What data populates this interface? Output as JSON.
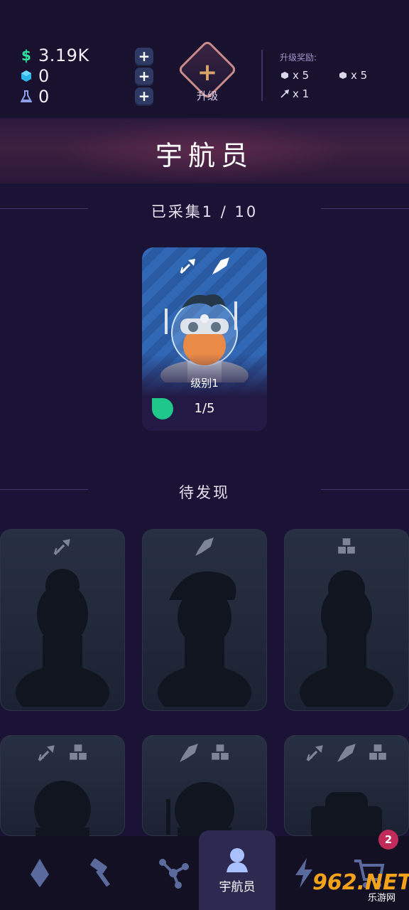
{
  "resources": {
    "coins": "3.19K",
    "gems": "0",
    "research": "0",
    "coin_symbol": "$"
  },
  "upgrade": {
    "label": "升级",
    "rewards_title": "升级奖励:",
    "reward_1": "x 5",
    "reward_2": "x 5",
    "reward_3": "x 1"
  },
  "header": {
    "title": "宇航员"
  },
  "collected": {
    "label": "已采集1 / 10"
  },
  "main_card": {
    "level_label": "级别1",
    "progress_label": "1/5",
    "progress_fraction": 0.2
  },
  "pending": {
    "label": "待发现"
  },
  "locked_cards": [
    {
      "icons": [
        "wrench-icon"
      ]
    },
    {
      "icons": [
        "rocket-icon"
      ]
    },
    {
      "icons": [
        "cubes-icon"
      ]
    },
    {
      "icons": [
        "wrench-icon",
        "cubes-icon"
      ]
    },
    {
      "icons": [
        "rocket-icon",
        "cubes-icon"
      ]
    },
    {
      "icons": [
        "wrench-icon",
        "rocket-icon",
        "cubes-icon"
      ]
    }
  ],
  "nav": {
    "items": [
      "diamond-icon",
      "hammer-icon",
      "network-icon",
      "astronaut-icon",
      "lightning-icon",
      "cart-icon"
    ],
    "active_label": "宇航员",
    "badge": "2"
  },
  "watermark": {
    "main": "962.NET",
    "sub": "乐游网"
  },
  "colors": {
    "background": "#1a1336",
    "card_blue": "#3168b6",
    "progress_green": "#1fc78a",
    "badge": "#c02b5a",
    "accent_gold": "#d7a46a"
  }
}
